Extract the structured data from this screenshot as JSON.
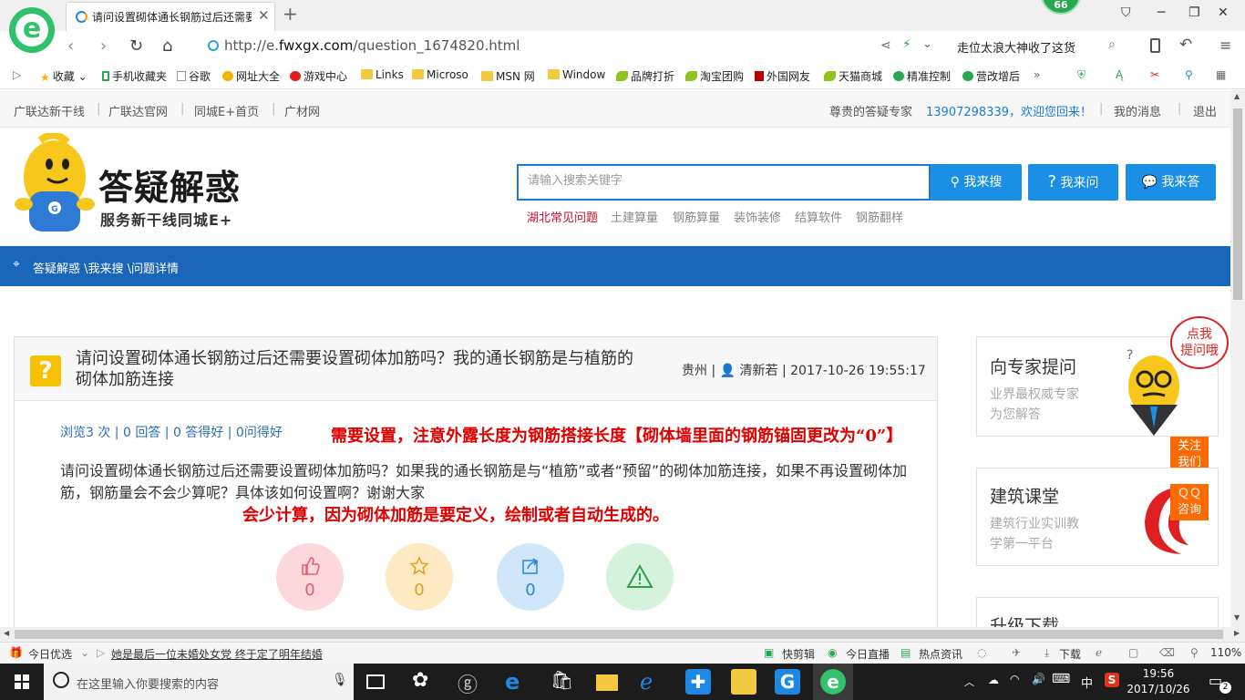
{
  "browser": {
    "tab_title": "请问设置砌体通长钢筋过后还需要设置砌体加筋吗？我的通长钢筋是与植筋的砌体加筋连接",
    "badge": "66",
    "url_prefix": "http://e.",
    "url_domain": "fwxgx.com",
    "url_path": "/question_1674820.html",
    "news_text": "走位太浪大神收了这货",
    "bookmarks": [
      "收藏",
      "手机收藏夹",
      "谷歌",
      "网址大全",
      "游戏中心",
      "Links",
      "Microso",
      "MSN 网",
      "Window",
      "品牌打折",
      "淘宝团购",
      "外国网友",
      "天猫商城",
      "精准控制",
      "营改增后"
    ]
  },
  "topnav": {
    "links": [
      "广联达新干线",
      "广联达官网",
      "同城E+首页",
      "广材网"
    ],
    "greeting": "尊贵的答疑专家",
    "user": "13907298339，欢迎您回来！",
    "messages": "我的消息",
    "logout": "退出"
  },
  "header": {
    "brand": "答疑解惑",
    "slogan": "服务新干线同城E+",
    "search_placeholder": "请输入搜索关键字",
    "btn_search": "我来搜",
    "btn_ask": "我来问",
    "btn_answer": "我来答",
    "hot_tags": [
      "湖北常见问题",
      "土建算量",
      "钢筋算量",
      "装饰装修",
      "结算软件",
      "钢筋翻样"
    ]
  },
  "breadcrumb": "答疑解惑 \\我来搜 \\问题详情",
  "question": {
    "title": "请问设置砌体通长钢筋过后还需要设置砌体加筋吗？我的通长钢筋是与植筋的砌体加筋连接",
    "meta": "贵州 | 清新若 | 2017-10-26 19:55:17",
    "meta_region": "贵州",
    "meta_user": "清新若",
    "meta_time": "2017-10-26 19:55:17",
    "stats": "浏览3 次 | 0 回答 | 0 答得好 | 0问得好",
    "body": "请问设置砌体通长钢筋过后还需要设置砌体加筋吗？如果我的通长钢筋是与“植筋”或者“预留”的砌体加筋连接，如果不再设置砌体加筋，钢筋量会不会少算呢？具体该如何设置啊？谢谢大家",
    "like_count": "0",
    "fav_count": "0",
    "share_count": "0"
  },
  "annotations": {
    "line1": "需要设置，注意外露长度为钢筋搭接长度【砌体墙里面的钢筋锚固更改为“0”】",
    "line2": "会少计算，因为砌体加筋是要定义，绘制或者自动生成的。"
  },
  "sidebar": {
    "expert_title": "向专家提问",
    "expert_desc1": "业界最权威专家",
    "expert_desc2": "为您解答",
    "bubble1": "点我",
    "bubble2": "提问哦",
    "follow1": "关注",
    "follow2": "我们",
    "course_title": "建筑课堂",
    "course_desc1": "建筑行业实训教",
    "course_desc2": "学第一平台",
    "qq1": "ＱＱ",
    "qq2": "咨询",
    "download_title": "升级下载"
  },
  "statusbar": {
    "today": "今日优选",
    "news": "她是最后一位未婚处女党 终于定了明年结婚",
    "items": [
      "快剪辑",
      "今日直播",
      "热点资讯"
    ],
    "download": "下载",
    "zoom": "110%"
  },
  "taskbar": {
    "search_placeholder": "在这里输入你要搜索的内容",
    "ime": "中",
    "time": "19:56",
    "date": "2017/10/26",
    "notif": "2"
  }
}
